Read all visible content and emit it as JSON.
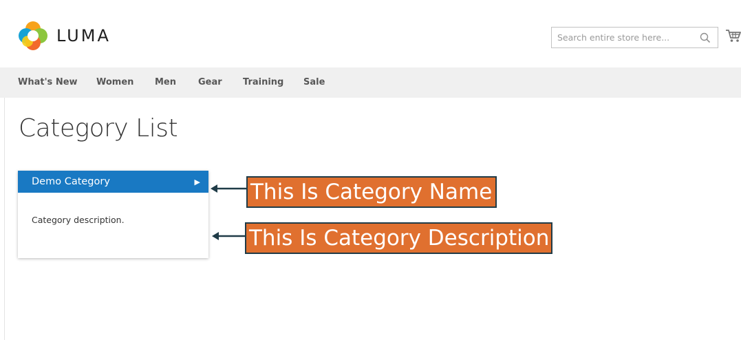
{
  "header": {
    "logo_text": "LUMA",
    "search_placeholder": "Search entire store here...",
    "icons": {
      "search": "search-icon",
      "cart": "cart-icon"
    }
  },
  "nav": {
    "items": [
      {
        "label": "What's New"
      },
      {
        "label": "Women"
      },
      {
        "label": "Men"
      },
      {
        "label": "Gear"
      },
      {
        "label": "Training"
      },
      {
        "label": "Sale"
      }
    ]
  },
  "main": {
    "page_title": "Category List",
    "category": {
      "name": "Demo Category",
      "arrow_glyph": "▶",
      "description": "Category description."
    }
  },
  "annotations": {
    "name_label": "This Is Category Name",
    "description_label": "This Is Category Description"
  },
  "colors": {
    "accent_blue": "#1979c3",
    "annotation_orange": "#e0702f",
    "annotation_border": "#1f3b47",
    "nav_background": "#f0f0f0"
  }
}
